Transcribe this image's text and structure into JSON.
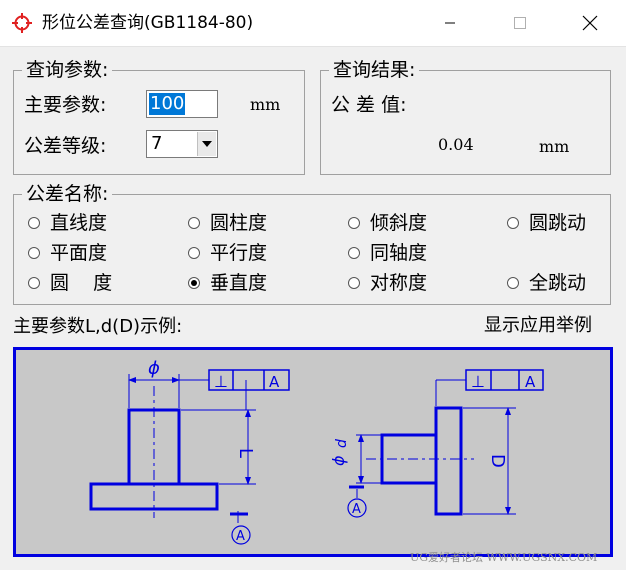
{
  "window": {
    "title": "形位公差查询(GB1184-80)"
  },
  "query_params": {
    "legend": "查询参数:",
    "main_param_label": "主要参数:",
    "main_param_value": "100",
    "main_param_unit": "mm",
    "grade_label": "公差等级:",
    "grade_value": "7"
  },
  "result": {
    "legend": "查询结果:",
    "value_label": "公 差 值:",
    "value": "0.04",
    "unit": "mm"
  },
  "tolerance_names": {
    "legend": "公差名称:",
    "options": [
      {
        "label": "直线度",
        "selected": false
      },
      {
        "label": "圆柱度",
        "selected": false
      },
      {
        "label": "倾斜度",
        "selected": false
      },
      {
        "label": "圆跳动",
        "selected": false
      },
      {
        "label": "平面度",
        "selected": false
      },
      {
        "label": "平行度",
        "selected": false
      },
      {
        "label": "同轴度",
        "selected": false
      },
      {
        "label": "圆    度",
        "selected": false
      },
      {
        "label": "垂直度",
        "selected": true
      },
      {
        "label": "对称度",
        "selected": false
      },
      {
        "label": "全跳动",
        "selected": false
      }
    ]
  },
  "example": {
    "caption": "主要参数L,d(D)示例:",
    "link": "显示应用举例",
    "diagram_left": {
      "phi": "ϕ",
      "frame_symbol": "⊥",
      "frame_datum": "A",
      "dim_label": "L",
      "datum_label": "A"
    },
    "diagram_right": {
      "phi": "ϕ",
      "small_dim_label": "d",
      "frame_symbol": "⊥",
      "frame_datum": "A",
      "dim_label": "D",
      "datum_label": "A"
    },
    "line_color": "#0000e0"
  },
  "watermark": "UG爱好者论坛 WWW.UGSNX.COM"
}
